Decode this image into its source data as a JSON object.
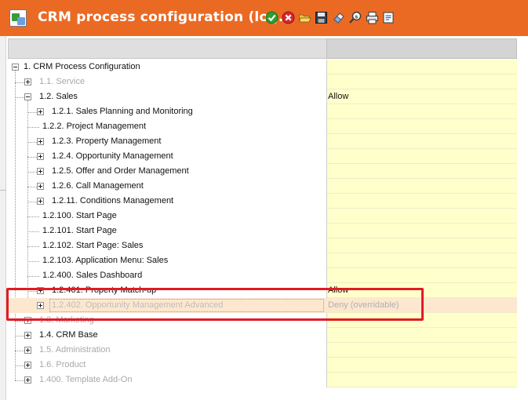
{
  "window": {
    "title": "CRM process configuration (log...",
    "toolbar": [
      {
        "name": "ok-check-icon",
        "tip": ""
      },
      {
        "name": "cancel-x-icon",
        "tip": ""
      },
      {
        "name": "open-folder-icon",
        "tip": ""
      },
      {
        "name": "save-disk-icon",
        "tip": ""
      },
      {
        "name": "eraser-icon",
        "tip": ""
      },
      {
        "name": "search-s-icon",
        "tip": ""
      },
      {
        "name": "print-icon",
        "tip": ""
      },
      {
        "name": "export-icon",
        "tip": ""
      }
    ]
  },
  "tree": {
    "rows": [
      {
        "label": "1. CRM Process Configuration",
        "level": 0,
        "toggle": "minus",
        "style": "normal",
        "value": ""
      },
      {
        "label": "1.1. Service",
        "level": 1,
        "toggle": "plus",
        "style": "dim",
        "value": ""
      },
      {
        "label": "1.2. Sales",
        "level": 1,
        "toggle": "minus",
        "style": "normal",
        "value": "Allow"
      },
      {
        "label": "1.2.1. Sales Planning and Monitoring",
        "level": 2,
        "toggle": "plus",
        "style": "normal",
        "value": ""
      },
      {
        "label": "1.2.2. Project Management",
        "level": 2,
        "toggle": "none",
        "style": "normal",
        "value": ""
      },
      {
        "label": "1.2.3. Property Management",
        "level": 2,
        "toggle": "plus",
        "style": "normal",
        "value": ""
      },
      {
        "label": "1.2.4. Opportunity Management",
        "level": 2,
        "toggle": "plus",
        "style": "normal",
        "value": ""
      },
      {
        "label": "1.2.5. Offer and Order Management",
        "level": 2,
        "toggle": "plus",
        "style": "normal",
        "value": ""
      },
      {
        "label": "1.2.6. Call Management",
        "level": 2,
        "toggle": "plus",
        "style": "normal",
        "value": ""
      },
      {
        "label": "1.2.11. Conditions Management",
        "level": 2,
        "toggle": "plus",
        "style": "normal",
        "value": ""
      },
      {
        "label": "1.2.100. Start Page",
        "level": 2,
        "toggle": "none",
        "style": "normal",
        "value": ""
      },
      {
        "label": "1.2.101. Start Page",
        "level": 2,
        "toggle": "none",
        "style": "normal",
        "value": ""
      },
      {
        "label": "1.2.102. Start Page: Sales",
        "level": 2,
        "toggle": "none",
        "style": "normal",
        "value": ""
      },
      {
        "label": "1.2.103. Application Menu: Sales",
        "level": 2,
        "toggle": "none",
        "style": "normal",
        "value": ""
      },
      {
        "label": "1.2.400. Sales Dashboard",
        "level": 2,
        "toggle": "none",
        "style": "normal",
        "value": ""
      },
      {
        "label": "1.2.401. Property Match-up",
        "level": 2,
        "toggle": "plus",
        "style": "normal",
        "value": "Allow"
      },
      {
        "label": "1.2.402. Opportunity Management Advanced",
        "level": 2,
        "toggle": "plus",
        "style": "selected",
        "value": "Deny (overridable)"
      },
      {
        "label": "1.3. Marketing",
        "level": 1,
        "toggle": "plus",
        "style": "dim",
        "value": ""
      },
      {
        "label": "1.4. CRM Base",
        "level": 1,
        "toggle": "plus",
        "style": "normal",
        "value": ""
      },
      {
        "label": "1.5. Administration",
        "level": 1,
        "toggle": "plus",
        "style": "dim",
        "value": ""
      },
      {
        "label": "1.6. Product",
        "level": 1,
        "toggle": "plus",
        "style": "dim",
        "value": ""
      },
      {
        "label": "1.400. Template Add-On",
        "level": 1,
        "toggle": "plus",
        "style": "dim",
        "value": ""
      }
    ]
  },
  "colors": {
    "titlebar": "#ea6a24",
    "value_cell": "#ffffcc",
    "selected_row": "#fde7cf",
    "highlight_box": "#e11b22"
  }
}
